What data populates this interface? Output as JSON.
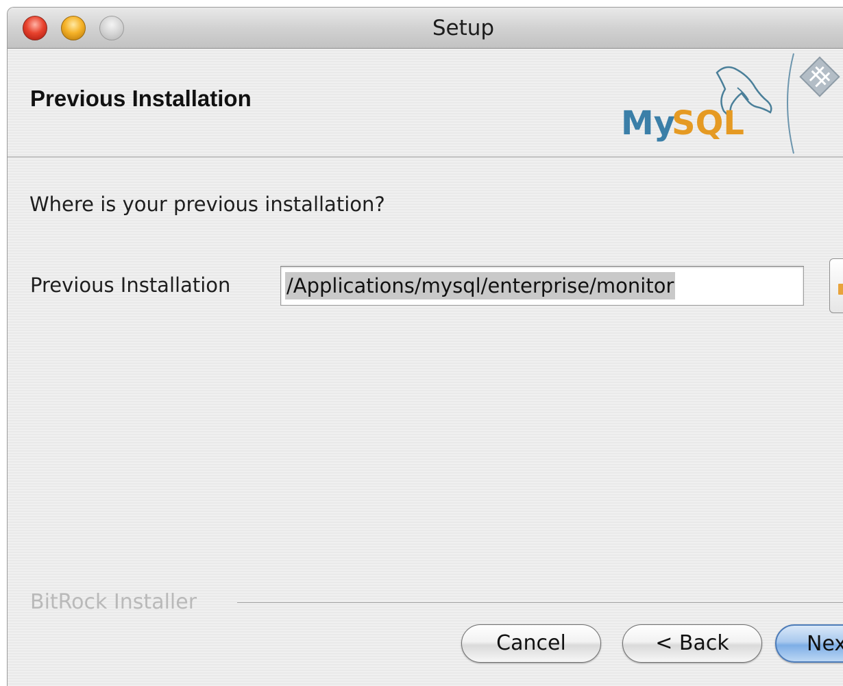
{
  "window": {
    "title": "Setup"
  },
  "header": {
    "title": "Previous Installation",
    "logo_text": "MySQL"
  },
  "main": {
    "question": "Where is your previous installation?",
    "field_label": "Previous Installation",
    "field_value": "/Applications/mysql/enterprise/monitor",
    "browse_icon": "folder-icon"
  },
  "footer": {
    "brand": "BitRock Installer",
    "buttons": {
      "cancel": "Cancel",
      "back": "< Back",
      "next": "Next"
    }
  },
  "colors": {
    "mysql_blue": "#3b7fa8",
    "mysql_orange": "#e59a23",
    "default_button_blue": "#7eaee6"
  }
}
